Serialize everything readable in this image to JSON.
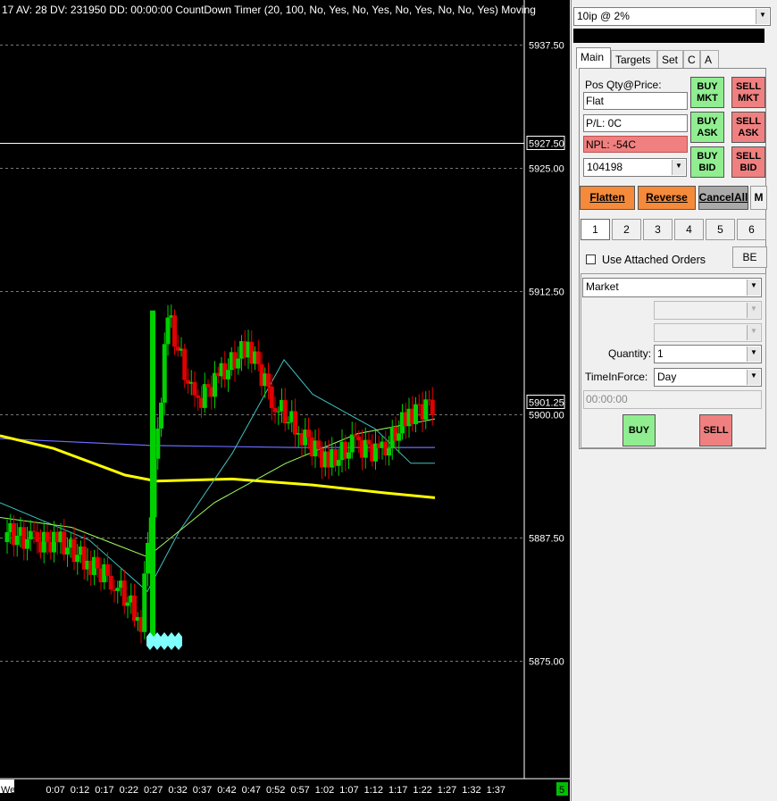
{
  "chart": {
    "header_text": "17 AV: 28 DV: 231950 DD: 00:00:00 CountDown Timer   (20, 100, No, Yes, No, Yes, No, Yes, No, No, Yes)  Moving",
    "price_labels": [
      "5937.50",
      "5927.50",
      "5925.00",
      "5912.50",
      "5901.25",
      "5900.00",
      "5887.50",
      "5875.00"
    ],
    "time_labels": [
      "We",
      "0:07",
      "0:12",
      "0:17",
      "0:22",
      "0:27",
      "0:32",
      "0:37",
      "0:42",
      "0:47",
      "0:52",
      "0:57",
      "1:02",
      "1:07",
      "1:12",
      "1:17",
      "1:22",
      "1:27",
      "1:32",
      "1:37"
    ],
    "corner_badge": "5",
    "colors": {
      "up": "#00d000",
      "down": "#e00000",
      "ma_yellow": "#ffff00",
      "ma_blue": "#6a6aff",
      "ma_cyan": "#40c0c0",
      "ma_lime": "#a0ff60"
    }
  },
  "chart_data": {
    "type": "candlestick",
    "ylim": [
      5863,
      5942
    ],
    "x": [
      "0:02",
      "0:07",
      "0:12",
      "0:17",
      "0:22",
      "0:27",
      "0:32",
      "0:37",
      "0:42",
      "0:47",
      "0:52",
      "0:57",
      "1:02",
      "1:07",
      "1:12",
      "1:17",
      "1:22"
    ],
    "close": [
      5888,
      5887,
      5887,
      5885,
      5883,
      5879,
      5910,
      5901,
      5904,
      5907,
      5901,
      5898,
      5895,
      5897,
      5896,
      5900,
      5901.25
    ],
    "price_line": 5927.5,
    "last_price": 5901.25
  },
  "panel": {
    "top_combo": "10ip @ 2%",
    "tabs": [
      "Main",
      "Targets",
      "Set",
      "C",
      "A"
    ],
    "pos_label": "Pos Qty@Price:",
    "pos_value": "Flat",
    "pl_value": "P/L: 0C",
    "npl_value": "NPL: -54C",
    "account_value": "104198",
    "buy_mkt": [
      "BUY",
      "MKT"
    ],
    "sell_mkt": [
      "SELL",
      "MKT"
    ],
    "buy_ask": [
      "BUY",
      "ASK"
    ],
    "sell_ask": [
      "SELL",
      "ASK"
    ],
    "buy_bid": [
      "BUY",
      "BID"
    ],
    "sell_bid": [
      "SELL",
      "BID"
    ],
    "flatten": "Flatten",
    "reverse": "Reverse",
    "cancel_all": "CancelAll",
    "m_button": "M",
    "number_buttons": [
      "1",
      "2",
      "3",
      "4",
      "5",
      "6"
    ],
    "use_attached_orders": "Use Attached Orders",
    "be_button": "BE",
    "order_type": "Market",
    "quantity_label": "Quantity:",
    "quantity_value": "1",
    "tif_label": "TimeInForce:",
    "tif_value": "Day",
    "time_value": "00:00:00",
    "buy_label": "BUY",
    "sell_label": "SELL"
  }
}
